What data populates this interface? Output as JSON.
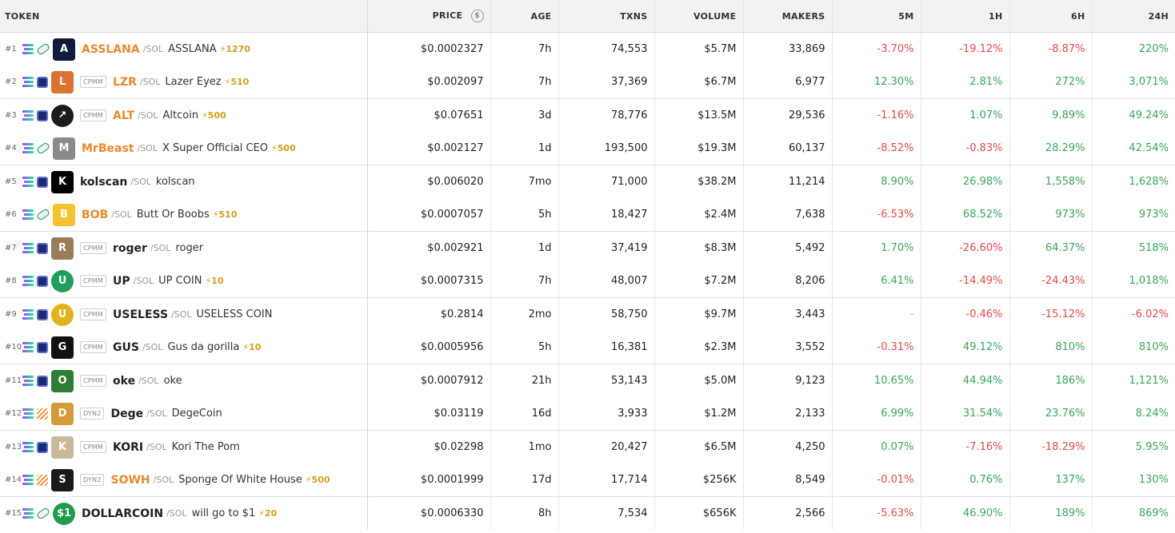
{
  "headers": {
    "token": "TOKEN",
    "price": "PRICE",
    "age": "AGE",
    "txns": "TXNS",
    "volume": "VOLUME",
    "makers": "MAKERS",
    "m5": "5M",
    "h1": "1H",
    "h6": "6H",
    "h24": "24H"
  },
  "colors": {
    "positive": "#3aa45c",
    "negative": "#e14a4a",
    "boosted": "#e8892e",
    "boost_bolt": "#d4a017"
  },
  "rows": [
    {
      "rank": "#1",
      "dex": "pump-icon",
      "badge": "",
      "symbol": "ASSLANA",
      "boosted": true,
      "chain": "/SOL",
      "name": "ASSLANA",
      "boost": "⚡1270",
      "avatar_color": "#0f1a3d",
      "avatar_text": "A",
      "price": "$0.0002327",
      "age": "7h",
      "txns": "74,553",
      "volume": "$5.7M",
      "makers": "33,869",
      "m5": "-3.70%",
      "h1": "-19.12%",
      "h6": "-8.87%",
      "h24": "220%"
    },
    {
      "rank": "#2",
      "dex": "raydium-icon",
      "badge": "CPMM",
      "symbol": "LZR",
      "boosted": true,
      "chain": "/SOL",
      "name": "Lazer Eyez",
      "boost": "⚡510",
      "avatar_color": "#d9732f",
      "avatar_text": "L",
      "price": "$0.002097",
      "age": "7h",
      "txns": "37,369",
      "volume": "$6.7M",
      "makers": "6,977",
      "m5": "12.30%",
      "h1": "2.81%",
      "h6": "272%",
      "h24": "3,071%"
    },
    {
      "rank": "#3",
      "dex": "raydium-icon",
      "badge": "CPMM",
      "symbol": "ALT",
      "boosted": true,
      "chain": "/SOL",
      "name": "Altcoin",
      "boost": "⚡500",
      "avatar_color": "#1c1c1c",
      "avatar_text": "↗",
      "price": "$0.07651",
      "age": "3d",
      "txns": "78,776",
      "volume": "$13.5M",
      "makers": "29,536",
      "m5": "-1.16%",
      "h1": "1.07%",
      "h6": "9.89%",
      "h24": "49.24%"
    },
    {
      "rank": "#4",
      "dex": "pump-icon",
      "badge": "",
      "symbol": "MrBeast",
      "boosted": true,
      "chain": "/SOL",
      "name": "X Super Official CEO",
      "boost": "⚡500",
      "avatar_color": "#8a8a8a",
      "avatar_text": "M",
      "price": "$0.002127",
      "age": "1d",
      "txns": "193,500",
      "volume": "$19.3M",
      "makers": "60,137",
      "m5": "-8.52%",
      "h1": "-0.83%",
      "h6": "28.29%",
      "h24": "42.54%"
    },
    {
      "rank": "#5",
      "dex": "raydium-icon",
      "badge": "",
      "symbol": "kolscan",
      "boosted": false,
      "chain": "/SOL",
      "name": "kolscan",
      "boost": "",
      "avatar_color": "#000000",
      "avatar_text": "K",
      "price": "$0.006020",
      "age": "7mo",
      "txns": "71,000",
      "volume": "$38.2M",
      "makers": "11,214",
      "m5": "8.90%",
      "h1": "26.98%",
      "h6": "1,558%",
      "h24": "1,628%"
    },
    {
      "rank": "#6",
      "dex": "pump-icon",
      "badge": "",
      "symbol": "BOB",
      "boosted": true,
      "chain": "/SOL",
      "name": "Butt Or Boobs",
      "boost": "⚡510",
      "avatar_color": "#f2c230",
      "avatar_text": "B",
      "price": "$0.0007057",
      "age": "5h",
      "txns": "18,427",
      "volume": "$2.4M",
      "makers": "7,638",
      "m5": "-6.53%",
      "h1": "68.52%",
      "h6": "973%",
      "h24": "973%"
    },
    {
      "rank": "#7",
      "dex": "raydium-icon",
      "badge": "CPMM",
      "symbol": "roger",
      "boosted": false,
      "chain": "/SOL",
      "name": "roger",
      "boost": "",
      "avatar_color": "#9a7b5a",
      "avatar_text": "R",
      "price": "$0.002921",
      "age": "1d",
      "txns": "37,419",
      "volume": "$8.3M",
      "makers": "5,492",
      "m5": "1.70%",
      "h1": "-26.60%",
      "h6": "64.37%",
      "h24": "518%"
    },
    {
      "rank": "#8",
      "dex": "raydium-icon",
      "badge": "CPMM",
      "symbol": "UP",
      "boosted": false,
      "chain": "/SOL",
      "name": "UP COIN",
      "boost": "⚡10",
      "avatar_color": "#1e9e5a",
      "avatar_text": "U",
      "price": "$0.0007315",
      "age": "7h",
      "txns": "48,007",
      "volume": "$7.2M",
      "makers": "8,206",
      "m5": "6.41%",
      "h1": "-14.49%",
      "h6": "-24.43%",
      "h24": "1,018%"
    },
    {
      "rank": "#9",
      "dex": "raydium-icon",
      "badge": "CPMM",
      "symbol": "USELESS",
      "boosted": false,
      "chain": "/SOL",
      "name": "USELESS COIN",
      "boost": "",
      "avatar_color": "#e2b21c",
      "avatar_text": "U",
      "price": "$0.2814",
      "age": "2mo",
      "txns": "58,750",
      "volume": "$9.7M",
      "makers": "3,443",
      "m5": "-",
      "h1": "-0.46%",
      "h6": "-15.12%",
      "h24": "-6.02%"
    },
    {
      "rank": "#10",
      "dex": "raydium-icon",
      "badge": "CPMM",
      "symbol": "GUS",
      "boosted": false,
      "chain": "/SOL",
      "name": "Gus da gorilla",
      "boost": "⚡10",
      "avatar_color": "#111111",
      "avatar_text": "G",
      "price": "$0.0005956",
      "age": "5h",
      "txns": "16,381",
      "volume": "$2.3M",
      "makers": "3,552",
      "m5": "-0.31%",
      "h1": "49.12%",
      "h6": "810%",
      "h24": "810%"
    },
    {
      "rank": "#11",
      "dex": "raydium-icon",
      "badge": "CPMM",
      "symbol": "oke",
      "boosted": false,
      "chain": "/SOL",
      "name": "oke",
      "boost": "",
      "avatar_color": "#2e7d32",
      "avatar_text": "O",
      "price": "$0.0007912",
      "age": "21h",
      "txns": "53,143",
      "volume": "$5.0M",
      "makers": "9,123",
      "m5": "10.65%",
      "h1": "44.94%",
      "h6": "186%",
      "h24": "1,121%"
    },
    {
      "rank": "#12",
      "dex": "meteora-icon",
      "badge": "DYN2",
      "symbol": "Dege",
      "boosted": false,
      "chain": "/SOL",
      "name": "DegeCoin",
      "boost": "",
      "avatar_color": "#d59b3a",
      "avatar_text": "D",
      "price": "$0.03119",
      "age": "16d",
      "txns": "3,933",
      "volume": "$1.2M",
      "makers": "2,133",
      "m5": "6.99%",
      "h1": "31.54%",
      "h6": "23.76%",
      "h24": "8.24%"
    },
    {
      "rank": "#13",
      "dex": "raydium-icon",
      "badge": "CPMM",
      "symbol": "KORI",
      "boosted": false,
      "chain": "/SOL",
      "name": "Kori The Pom",
      "boost": "",
      "avatar_color": "#c9b89a",
      "avatar_text": "K",
      "price": "$0.02298",
      "age": "1mo",
      "txns": "20,427",
      "volume": "$6.5M",
      "makers": "4,250",
      "m5": "0.07%",
      "h1": "-7.16%",
      "h6": "-18.29%",
      "h24": "5.95%"
    },
    {
      "rank": "#14",
      "dex": "meteora-icon",
      "badge": "DYN2",
      "symbol": "SOWH",
      "boosted": true,
      "chain": "/SOL",
      "name": "Sponge Of White House",
      "boost": "⚡500",
      "avatar_color": "#1a1a1a",
      "avatar_text": "S",
      "price": "$0.0001999",
      "age": "17d",
      "txns": "17,714",
      "volume": "$256K",
      "makers": "8,549",
      "m5": "-0.01%",
      "h1": "0.76%",
      "h6": "137%",
      "h24": "130%"
    },
    {
      "rank": "#15",
      "dex": "pump-icon",
      "badge": "",
      "symbol": "DOLLARCOIN",
      "boosted": false,
      "chain": "/SOL",
      "name": "will go to $1",
      "boost": "⚡20",
      "avatar_color": "#1e9e4a",
      "avatar_text": "$1",
      "price": "$0.0006330",
      "age": "8h",
      "txns": "7,534",
      "volume": "$656K",
      "makers": "2,566",
      "m5": "-5.63%",
      "h1": "46.90%",
      "h6": "189%",
      "h24": "869%"
    }
  ]
}
